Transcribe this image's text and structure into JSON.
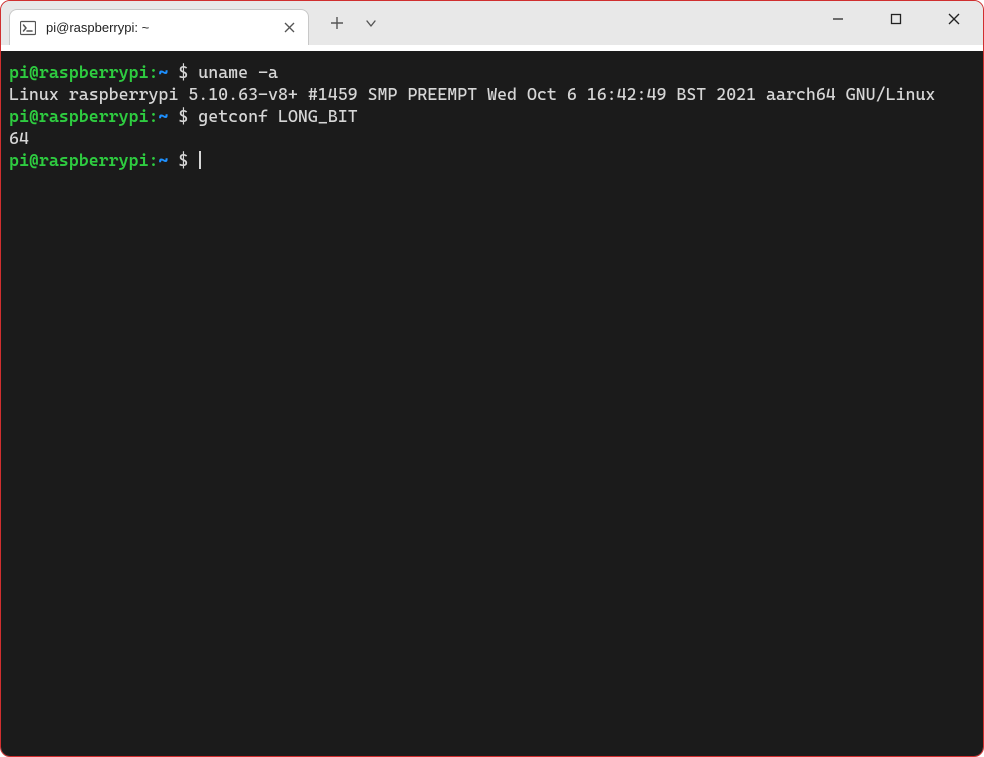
{
  "tab": {
    "title": "pi@raspberrypi: ~"
  },
  "prompt": {
    "user_host": "pi@raspberrypi",
    "sep": ":",
    "path": "~",
    "symbol": "$"
  },
  "lines": {
    "cmd1": "uname -a",
    "out1": "Linux raspberrypi 5.10.63-v8+ #1459 SMP PREEMPT Wed Oct 6 16:42:49 BST 2021 aarch64 GNU/Linux",
    "cmd2": "getconf LONG_BIT",
    "out2": "64"
  }
}
